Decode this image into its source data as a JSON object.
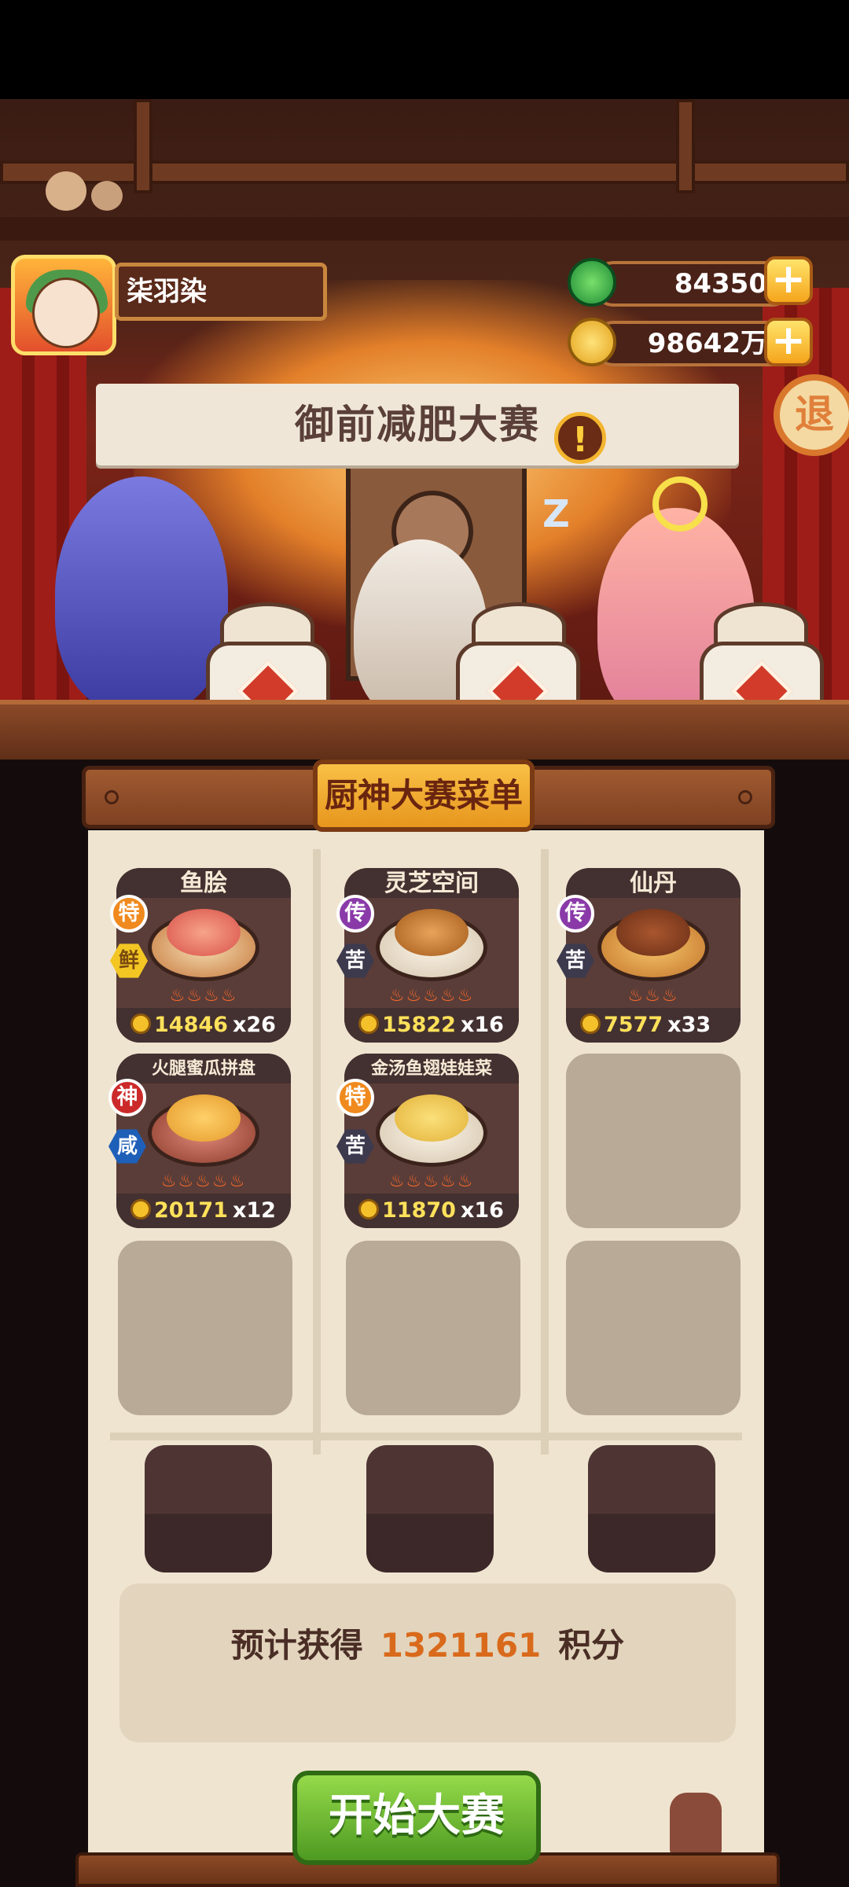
{
  "player": {
    "name": "柒羽染"
  },
  "currency": {
    "jade": {
      "value": "84350",
      "icon": "jade-icon"
    },
    "coins": {
      "value": "98642万",
      "icon": "coin-icon"
    }
  },
  "exit_label": "退",
  "event": {
    "title": "御前减肥大赛",
    "alert": "!"
  },
  "menu": {
    "title": "厨神大赛菜单",
    "dishes": [
      {
        "name": "鱼脍",
        "rank": "特",
        "flavor": "鲜",
        "flames": "♨♨♨♨",
        "price": "14846",
        "count": "x26"
      },
      {
        "name": "灵芝空间",
        "rank": "传",
        "flavor": "苦",
        "flames": "♨♨♨♨♨",
        "price": "15822",
        "count": "x16"
      },
      {
        "name": "仙丹",
        "rank": "传",
        "flavor": "苦",
        "flames": "♨♨♨",
        "price": "7577",
        "count": "x33"
      },
      {
        "name": "火腿蜜瓜拼盘",
        "rank": "神",
        "flavor": "咸",
        "flames": "♨♨♨♨♨",
        "price": "20171",
        "count": "x12"
      },
      {
        "name": "金汤鱼翅娃娃菜",
        "rank": "特",
        "flavor": "苦",
        "flames": "♨♨♨♨♨",
        "price": "11870",
        "count": "x16"
      }
    ]
  },
  "score": {
    "prefix": "预计获得",
    "value": "1321161",
    "suffix": "积分"
  },
  "start_button": "开始大赛",
  "colors": {
    "accent": "#f3b52f",
    "score": "#d96a1c",
    "start": "#5aa628"
  }
}
